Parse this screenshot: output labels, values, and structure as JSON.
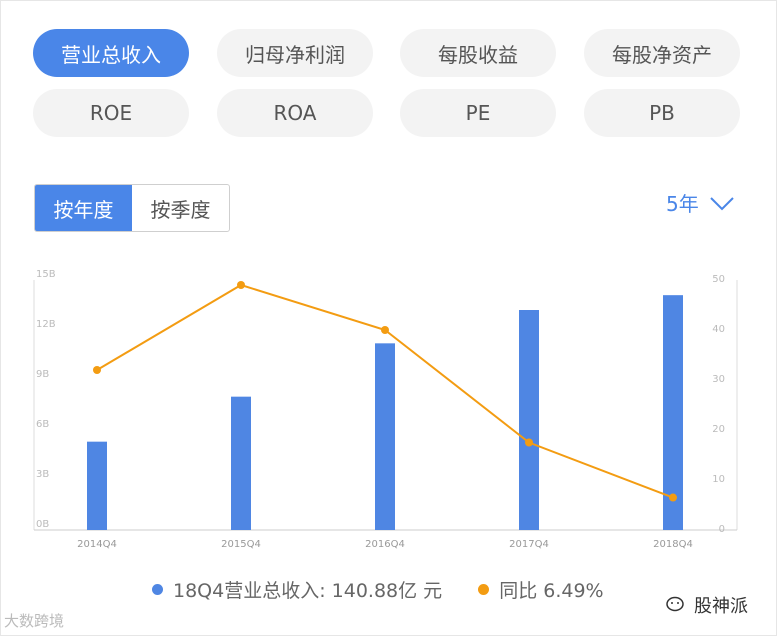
{
  "tabs": [
    {
      "label": "营业总收入",
      "active": true
    },
    {
      "label": "归母净利润",
      "active": false
    },
    {
      "label": "每股收益",
      "active": false
    },
    {
      "label": "每股净资产",
      "active": false
    },
    {
      "label": "ROE",
      "active": false
    },
    {
      "label": "ROA",
      "active": false
    },
    {
      "label": "PE",
      "active": false
    },
    {
      "label": "PB",
      "active": false
    }
  ],
  "period_toggle": {
    "annual": "按年度",
    "quarterly": "按季度",
    "selected": "annual"
  },
  "range": {
    "label": "5年"
  },
  "legend": {
    "revenue": "18Q4营业总收入: 140.88亿 元",
    "yoy": "同比 6.49%"
  },
  "colors": {
    "accent": "#4a86e8",
    "line": "#f39c12",
    "bar": "#4f86e3"
  },
  "watermark_left": "大数跨境",
  "watermark_right": "股神派",
  "chart_data": {
    "type": "bar",
    "categories": [
      "2014Q4",
      "2015Q4",
      "2016Q4",
      "2017Q4",
      "2018Q4"
    ],
    "series": [
      {
        "values": [
          5.3,
          8.0,
          11.2,
          13.2,
          14.09
        ],
        "axis": "left"
      },
      {
        "values": [
          32,
          49,
          40,
          17.5,
          6.49
        ],
        "axis": "right",
        "type": "line"
      }
    ],
    "y_left": {
      "min": 0,
      "max": 15,
      "ticks": [
        "0B",
        "3B",
        "6B",
        "9B",
        "12B",
        "15B"
      ]
    },
    "y_right": {
      "min": 0,
      "max": 50,
      "ticks": [
        "0",
        "10",
        "20",
        "30",
        "40",
        "50"
      ]
    },
    "grid": false,
    "legend_position": "bottom"
  }
}
